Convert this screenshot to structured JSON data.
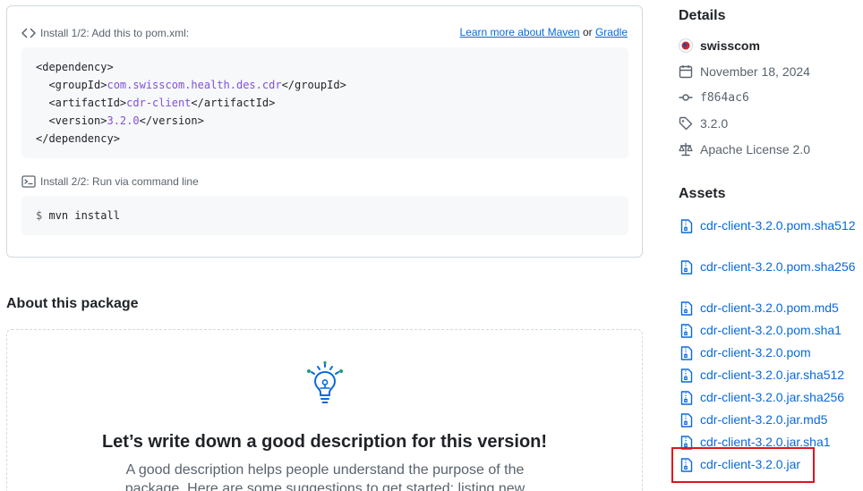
{
  "install": {
    "step1_label": "Install 1/2: Add this to pom.xml:",
    "learn_maven": "Learn more about Maven",
    "or": "or",
    "gradle": "Gradle",
    "code": {
      "dep_open": "<dependency>",
      "group_open": "<groupId>",
      "group_value": "com.swisscom.health.des.cdr",
      "group_close": "</groupId>",
      "artifact_open": "<artifactId>",
      "artifact_value": "cdr-client",
      "artifact_close": "</artifactId>",
      "version_open": "<version>",
      "version_value": "3.2.0",
      "version_close": "</version>",
      "dep_close": "</dependency>"
    },
    "step2_label": "Install 2/2: Run via command line",
    "cmd_prompt": "$",
    "cmd": "mvn install"
  },
  "about": {
    "title": "About this package",
    "heading": "Let’s write down a good description for this version!",
    "text": "A good description helps people understand the purpose of the package. Here are some suggestions to get started: listing new"
  },
  "details": {
    "title": "Details",
    "owner": "swisscom",
    "date": "November 18, 2024",
    "commit": "f864ac6",
    "version": "3.2.0",
    "license": "Apache License 2.0"
  },
  "assets": {
    "title": "Assets",
    "items": [
      "cdr-client-3.2.0.pom.sha512",
      "cdr-client-3.2.0.pom.sha256",
      "cdr-client-3.2.0.pom.md5",
      "cdr-client-3.2.0.pom.sha1",
      "cdr-client-3.2.0.pom",
      "cdr-client-3.2.0.jar.sha512",
      "cdr-client-3.2.0.jar.sha256",
      "cdr-client-3.2.0.jar.md5",
      "cdr-client-3.2.0.jar.sha1",
      "cdr-client-3.2.0.jar"
    ]
  },
  "colors": {
    "link": "#0969da",
    "muted": "#59636e",
    "highlight": "#e0141b",
    "code_value": "#8250df"
  }
}
